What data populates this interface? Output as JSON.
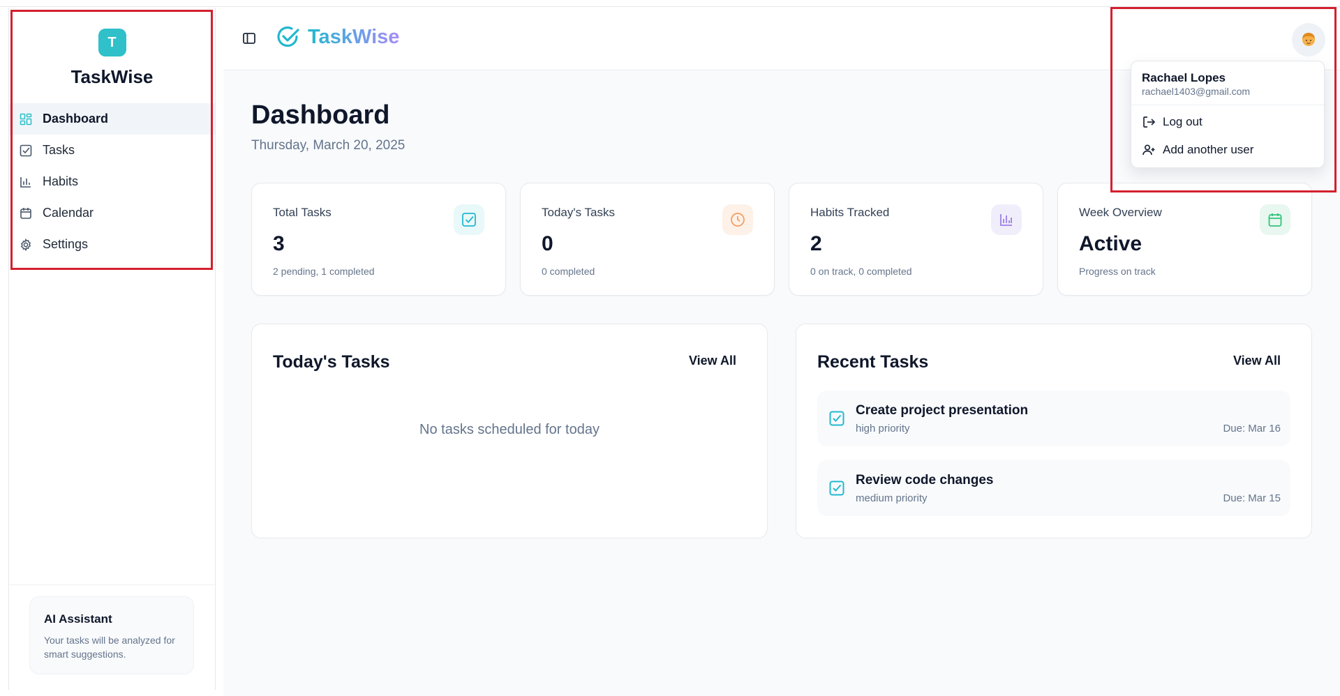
{
  "app": {
    "name": "TaskWise",
    "badge_letter": "T"
  },
  "sidebar": {
    "items": [
      {
        "label": "Dashboard",
        "icon": "grid-icon",
        "active": true
      },
      {
        "label": "Tasks",
        "icon": "check-square-icon",
        "active": false
      },
      {
        "label": "Habits",
        "icon": "bar-chart-icon",
        "active": false
      },
      {
        "label": "Calendar",
        "icon": "calendar-icon",
        "active": false
      },
      {
        "label": "Settings",
        "icon": "gear-icon",
        "active": false
      }
    ],
    "ai_card": {
      "title": "AI Assistant",
      "description": "Your tasks will be analyzed for smart suggestions."
    }
  },
  "header": {
    "logo_text": "TaskWise",
    "avatar_icon": "user-avatar-icon"
  },
  "page": {
    "title": "Dashboard",
    "date": "Thursday, March 20, 2025"
  },
  "stats": [
    {
      "label": "Total Tasks",
      "value": "3",
      "sub": "2 pending, 1 completed",
      "icon": "check-square-icon",
      "color": "#22b8cf",
      "bg": "#e9f8f9"
    },
    {
      "label": "Today's Tasks",
      "value": "0",
      "sub": "0 completed",
      "icon": "clock-icon",
      "color": "#f59e62",
      "bg": "#fdf1e8"
    },
    {
      "label": "Habits Tracked",
      "value": "2",
      "sub": "0 on track, 0 completed",
      "icon": "bar-chart-icon",
      "color": "#9b7ee8",
      "bg": "#f1eefc"
    },
    {
      "label": "Week Overview",
      "value": "Active",
      "sub": "Progress on track",
      "icon": "calendar-icon",
      "color": "#31c27c",
      "bg": "#e8f7ef"
    }
  ],
  "today_panel": {
    "title": "Today's Tasks",
    "view_all": "View All",
    "empty": "No tasks scheduled for today"
  },
  "recent_panel": {
    "title": "Recent Tasks",
    "view_all": "View All",
    "tasks": [
      {
        "title": "Create project presentation",
        "priority": "high priority",
        "due": "Due: Mar 16"
      },
      {
        "title": "Review code changes",
        "priority": "medium priority",
        "due": "Due: Mar 15"
      }
    ]
  },
  "user_menu": {
    "name": "Rachael Lopes",
    "email": "rachael1403@gmail.com",
    "logout": "Log out",
    "add_user": "Add another user"
  },
  "colors": {
    "brand": "#2fc0c9",
    "highlight": "#d41f2f"
  }
}
